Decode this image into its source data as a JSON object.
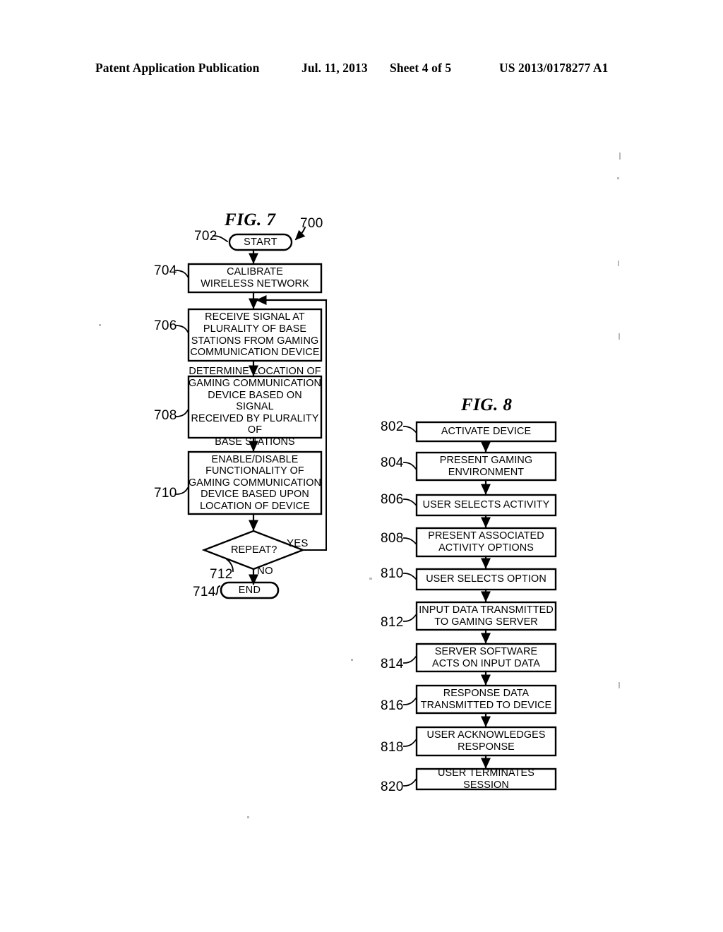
{
  "header": {
    "publication": "Patent Application Publication",
    "date": "Jul. 11, 2013",
    "sheet": "Sheet 4 of 5",
    "patent_number": "US 2013/0178277 A1"
  },
  "figures": [
    {
      "id": "fig7",
      "title": "FIG. 7",
      "diagram_ref": "700",
      "nodes": [
        {
          "ref": "702",
          "shape": "terminal",
          "text": "START"
        },
        {
          "ref": "704",
          "shape": "process",
          "text": "CALIBRATE\nWIRELESS NETWORK"
        },
        {
          "ref": "706",
          "shape": "process",
          "text": "RECEIVE SIGNAL AT\nPLURALITY OF BASE\nSTATIONS FROM GAMING\nCOMMUNICATION DEVICE"
        },
        {
          "ref": "708",
          "shape": "process",
          "text": "DETERMINE LOCATION OF\nGAMING COMMUNICATION\nDEVICE BASED ON SIGNAL\nRECEIVED BY PLURALITY OF\nBASE STATIONS"
        },
        {
          "ref": "710",
          "shape": "process",
          "text": "ENABLE/DISABLE\nFUNCTIONALITY OF\nGAMING COMMUNICATION\nDEVICE BASED UPON\nLOCATION OF DEVICE"
        },
        {
          "ref": "712",
          "shape": "decision",
          "text": "REPEAT?"
        },
        {
          "ref": "714",
          "shape": "terminal",
          "text": "END"
        }
      ],
      "branch_labels": {
        "yes": "YES",
        "no": "NO"
      }
    },
    {
      "id": "fig8",
      "title": "FIG. 8",
      "nodes": [
        {
          "ref": "802",
          "shape": "process",
          "text": "ACTIVATE DEVICE"
        },
        {
          "ref": "804",
          "shape": "process",
          "text": "PRESENT GAMING\nENVIRONMENT"
        },
        {
          "ref": "806",
          "shape": "process",
          "text": "USER SELECTS ACTIVITY"
        },
        {
          "ref": "808",
          "shape": "process",
          "text": "PRESENT ASSOCIATED\nACTIVITY OPTIONS"
        },
        {
          "ref": "810",
          "shape": "process",
          "text": "USER SELECTS OPTION"
        },
        {
          "ref": "812",
          "shape": "process",
          "text": "INPUT DATA TRANSMITTED\nTO GAMING SERVER"
        },
        {
          "ref": "814",
          "shape": "process",
          "text": "SERVER SOFTWARE\nACTS ON INPUT DATA"
        },
        {
          "ref": "816",
          "shape": "process",
          "text": "RESPONSE DATA\nTRANSMITTED TO DEVICE"
        },
        {
          "ref": "818",
          "shape": "process",
          "text": "USER ACKNOWLEDGES\nRESPONSE"
        },
        {
          "ref": "820",
          "shape": "process",
          "text": "USER TERMINATES SESSION"
        }
      ]
    }
  ]
}
